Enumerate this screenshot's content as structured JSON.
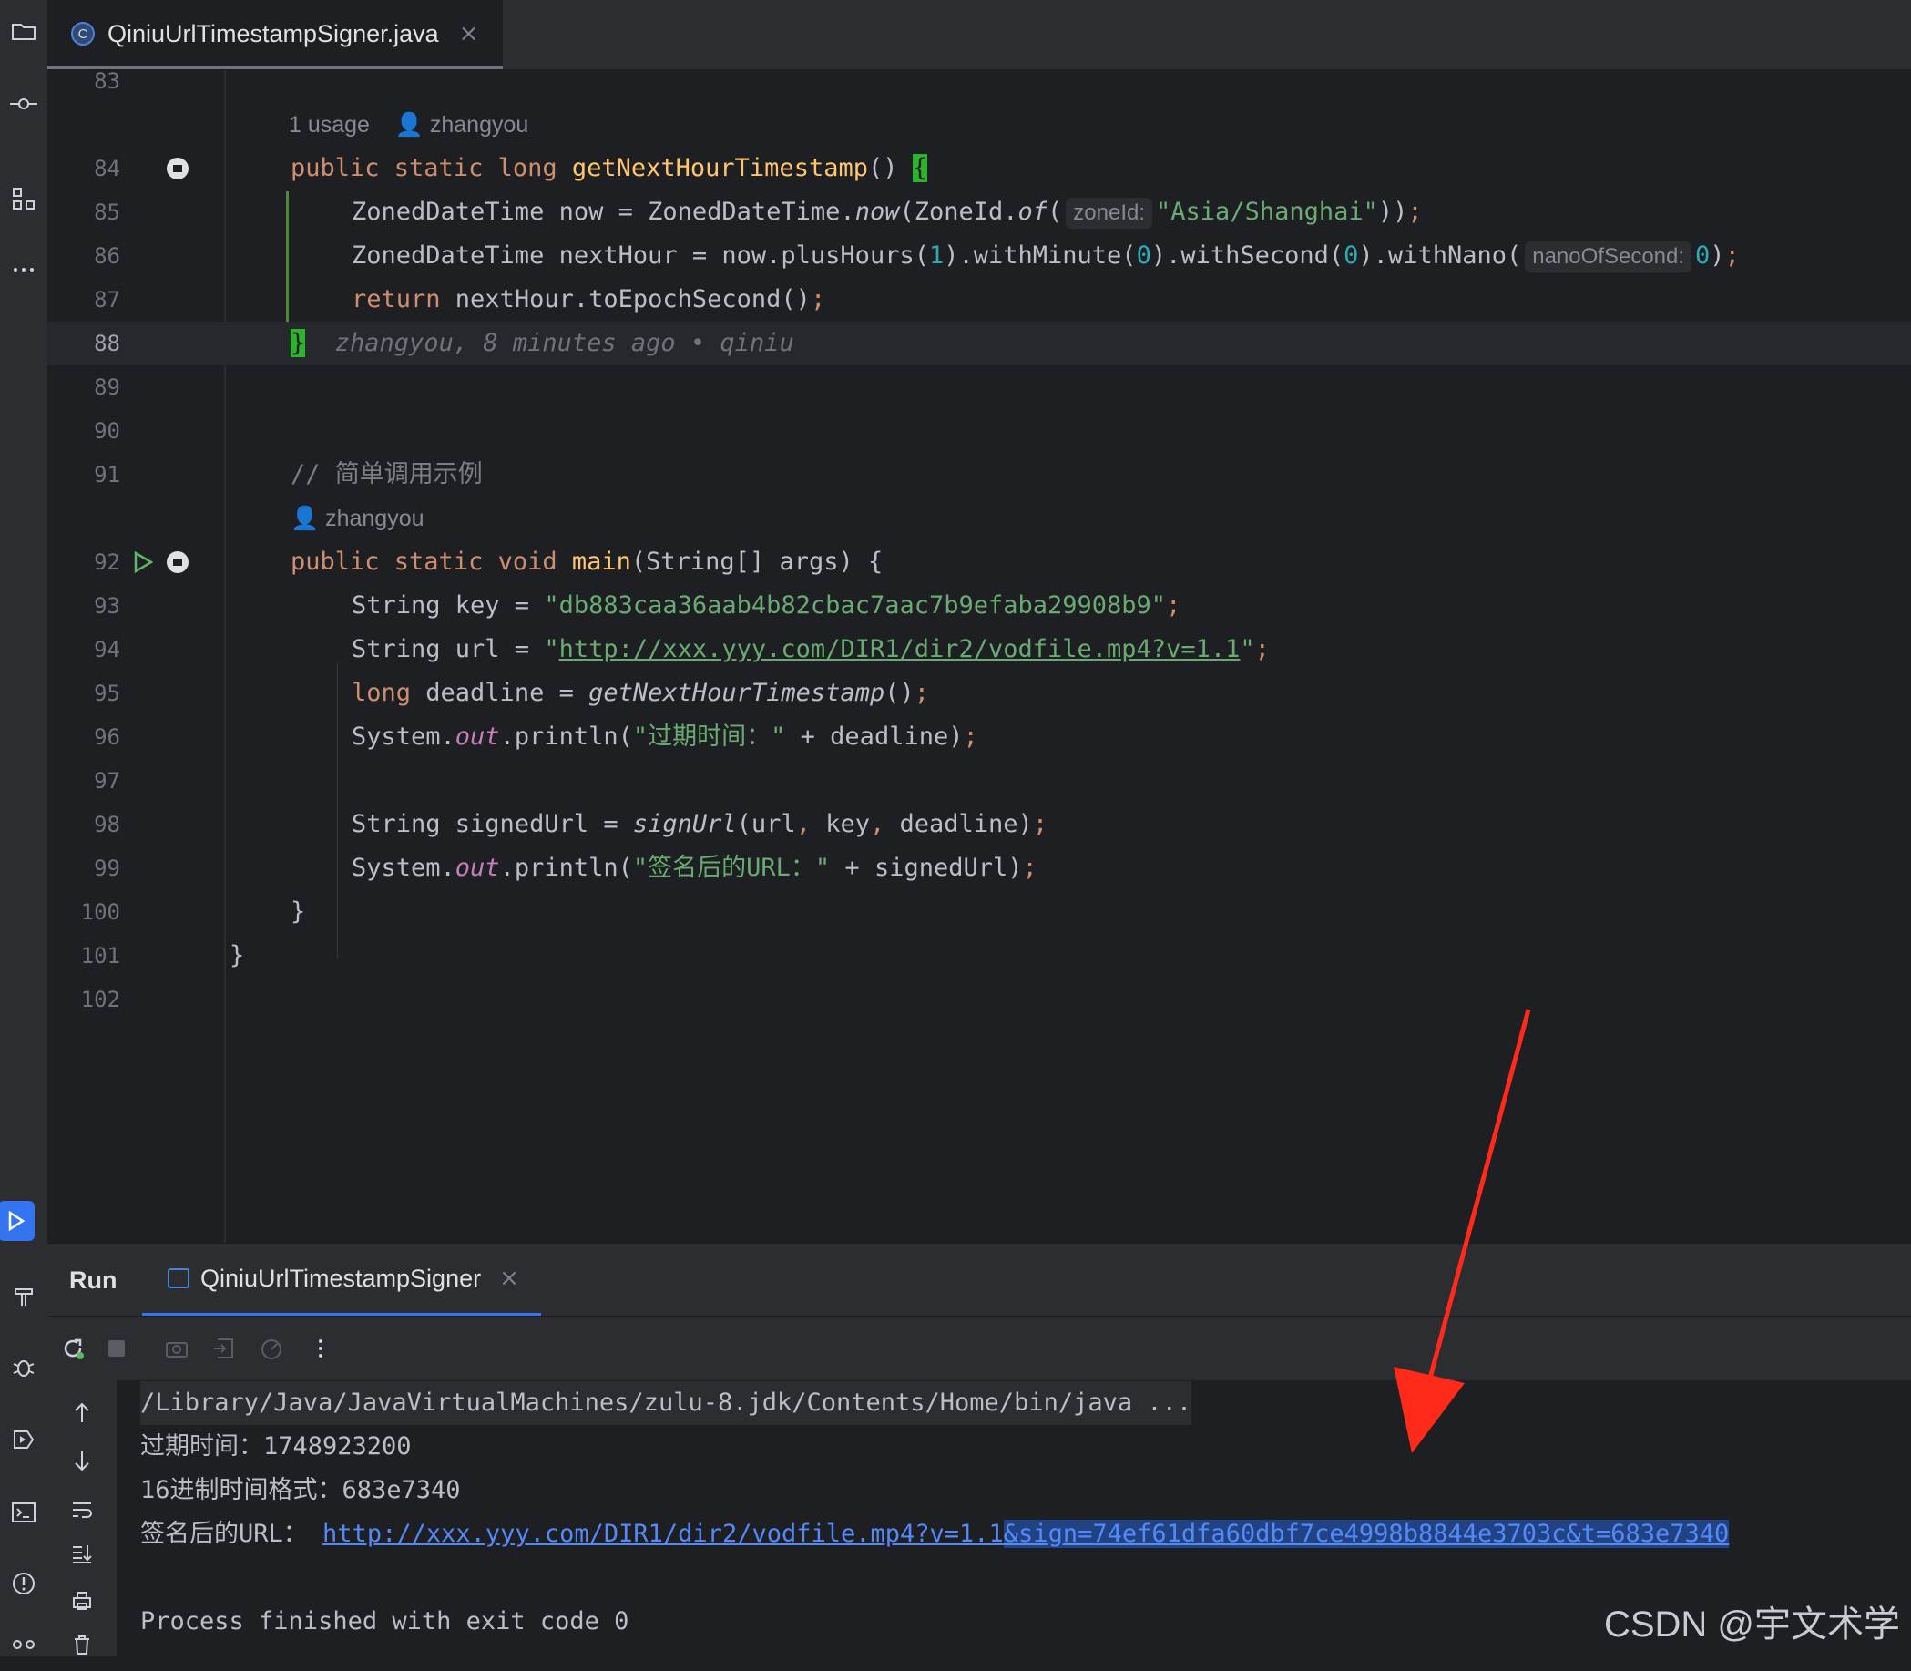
{
  "tab": {
    "icon_letter": "C",
    "label": "QiniuUrlTimestampSigner.java",
    "close": "×"
  },
  "editor": {
    "line_numbers": [
      "83",
      "84",
      "85",
      "86",
      "87",
      "88",
      "89",
      "90",
      "91",
      "92",
      "93",
      "94",
      "95",
      "96",
      "97",
      "98",
      "99",
      "100",
      "101",
      "102"
    ],
    "inlay_usage": "1 usage",
    "inlay_author_1": "zhangyou",
    "inlay_author_2": "zhangyou",
    "hint_zoneid": "zoneId:",
    "hint_nanos": "nanoOfSecond:",
    "blame": "zhangyou, 8 minutes ago • qiniu",
    "comment": "// 简单调用示例",
    "key_value": "\"db883caa36aab4b82cbac7aac7b9efaba29908b9\"",
    "url_value": "http://xxx.yyy.com/DIR1/dir2/vodfile.mp4?v=1.1",
    "print1_str": "\"过期时间：\"",
    "print2_str": "\"签名后的URL：\"",
    "zone_str": "\"Asia/Shanghai\""
  },
  "run": {
    "title": "Run",
    "tab_label": "QiniuUrlTimestampSigner",
    "close": "×",
    "console": {
      "cmd": "/Library/Java/JavaVirtualMachines/zulu-8.jdk/Contents/Home/bin/java ...",
      "line1": "过期时间：1748923200",
      "line2": "16进制时间格式：683e7340",
      "line3_prefix": "签名后的URL：",
      "url_part1": "http://xxx.yyy.com/DIR1/dir2/vodfile.mp4?v=1.1",
      "url_part2": "&sign=74ef61dfa60dbf7ce4998b8844e3703c&t=683e7340",
      "exit": "Process finished with exit code 0"
    }
  },
  "watermark": "CSDN @宇文术学",
  "colors": {
    "accent": "#3574f0",
    "keyword": "#cf8e6d",
    "string": "#6aab73",
    "arrow": "#ff2a1a"
  }
}
